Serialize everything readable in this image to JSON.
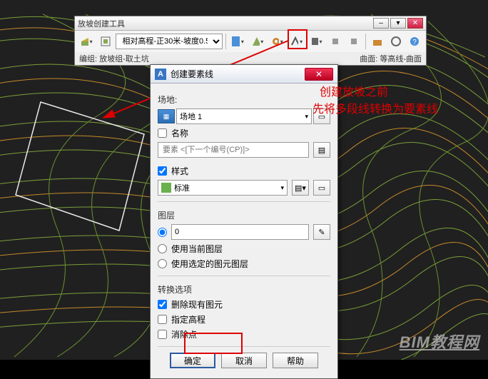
{
  "toolbar": {
    "window_title": "放坡创建工具",
    "combo_value": "相对高程-正30米-坡度0.5",
    "status_left": "编组: 放坡组-取土坑",
    "status_right": "曲面: 等高线-曲面",
    "icons": [
      "tool1",
      "tool2",
      "paint",
      "pick",
      "picker",
      "move",
      "stamp",
      "undo",
      "redo",
      "info",
      "folder",
      "help"
    ]
  },
  "dialog": {
    "title": "创建要素线",
    "group_site": "场地:",
    "site_value": "场地 1",
    "name_cb": "名称",
    "name_placeholder": "要素 <[下一个编号(CP)]>",
    "style_cb": "样式",
    "style_value": "标准",
    "layer_label": "图层",
    "layer_value": "0",
    "layer_opt1": "使用当前图层",
    "layer_opt2": "使用选定的图元图层",
    "conv_label": "转换选项",
    "conv_opt1": "删除现有图元",
    "conv_opt2": "指定高程",
    "conv_opt3": "消除点",
    "btn_ok": "确定",
    "btn_cancel": "取消",
    "btn_help": "帮助"
  },
  "annotations": {
    "line1": "创建放坡之前",
    "line2": "先将多段线转换为要素线"
  },
  "watermark": "BIM教程网"
}
